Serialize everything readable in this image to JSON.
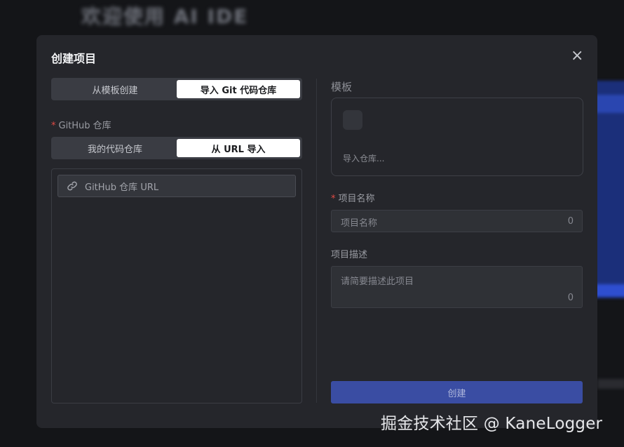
{
  "background": {
    "title": "欢迎使用 AI IDE"
  },
  "modal": {
    "title": "创建项目",
    "close_icon": "close-icon"
  },
  "source_tabs": {
    "options": [
      "从模板创建",
      "导入 Git 代码仓库"
    ],
    "selected": "导入 Git 代码仓库"
  },
  "github_repo": {
    "label": "GitHub 仓库",
    "required": true,
    "tabs": [
      "我的代码仓库",
      "从 URL 导入"
    ],
    "selected_tab": "从 URL 导入",
    "url_input": {
      "placeholder": "GitHub 仓库 URL",
      "value": "",
      "icon": "link-icon"
    }
  },
  "template": {
    "title": "模板",
    "hint": "导入仓库..."
  },
  "project_name": {
    "label": "项目名称",
    "required": true,
    "placeholder": "项目名称",
    "char_count": "0"
  },
  "project_description": {
    "label": "项目描述",
    "placeholder": "请简要描述此项目",
    "char_count": "0"
  },
  "create_button": {
    "label": "创建"
  },
  "watermark": "掘金技术社区 @ KaneLogger",
  "colors": {
    "modal_bg": "#25262b",
    "primary_button": "#3a4da3",
    "required_star": "#e04a44",
    "active_tab": "#ffffff"
  }
}
